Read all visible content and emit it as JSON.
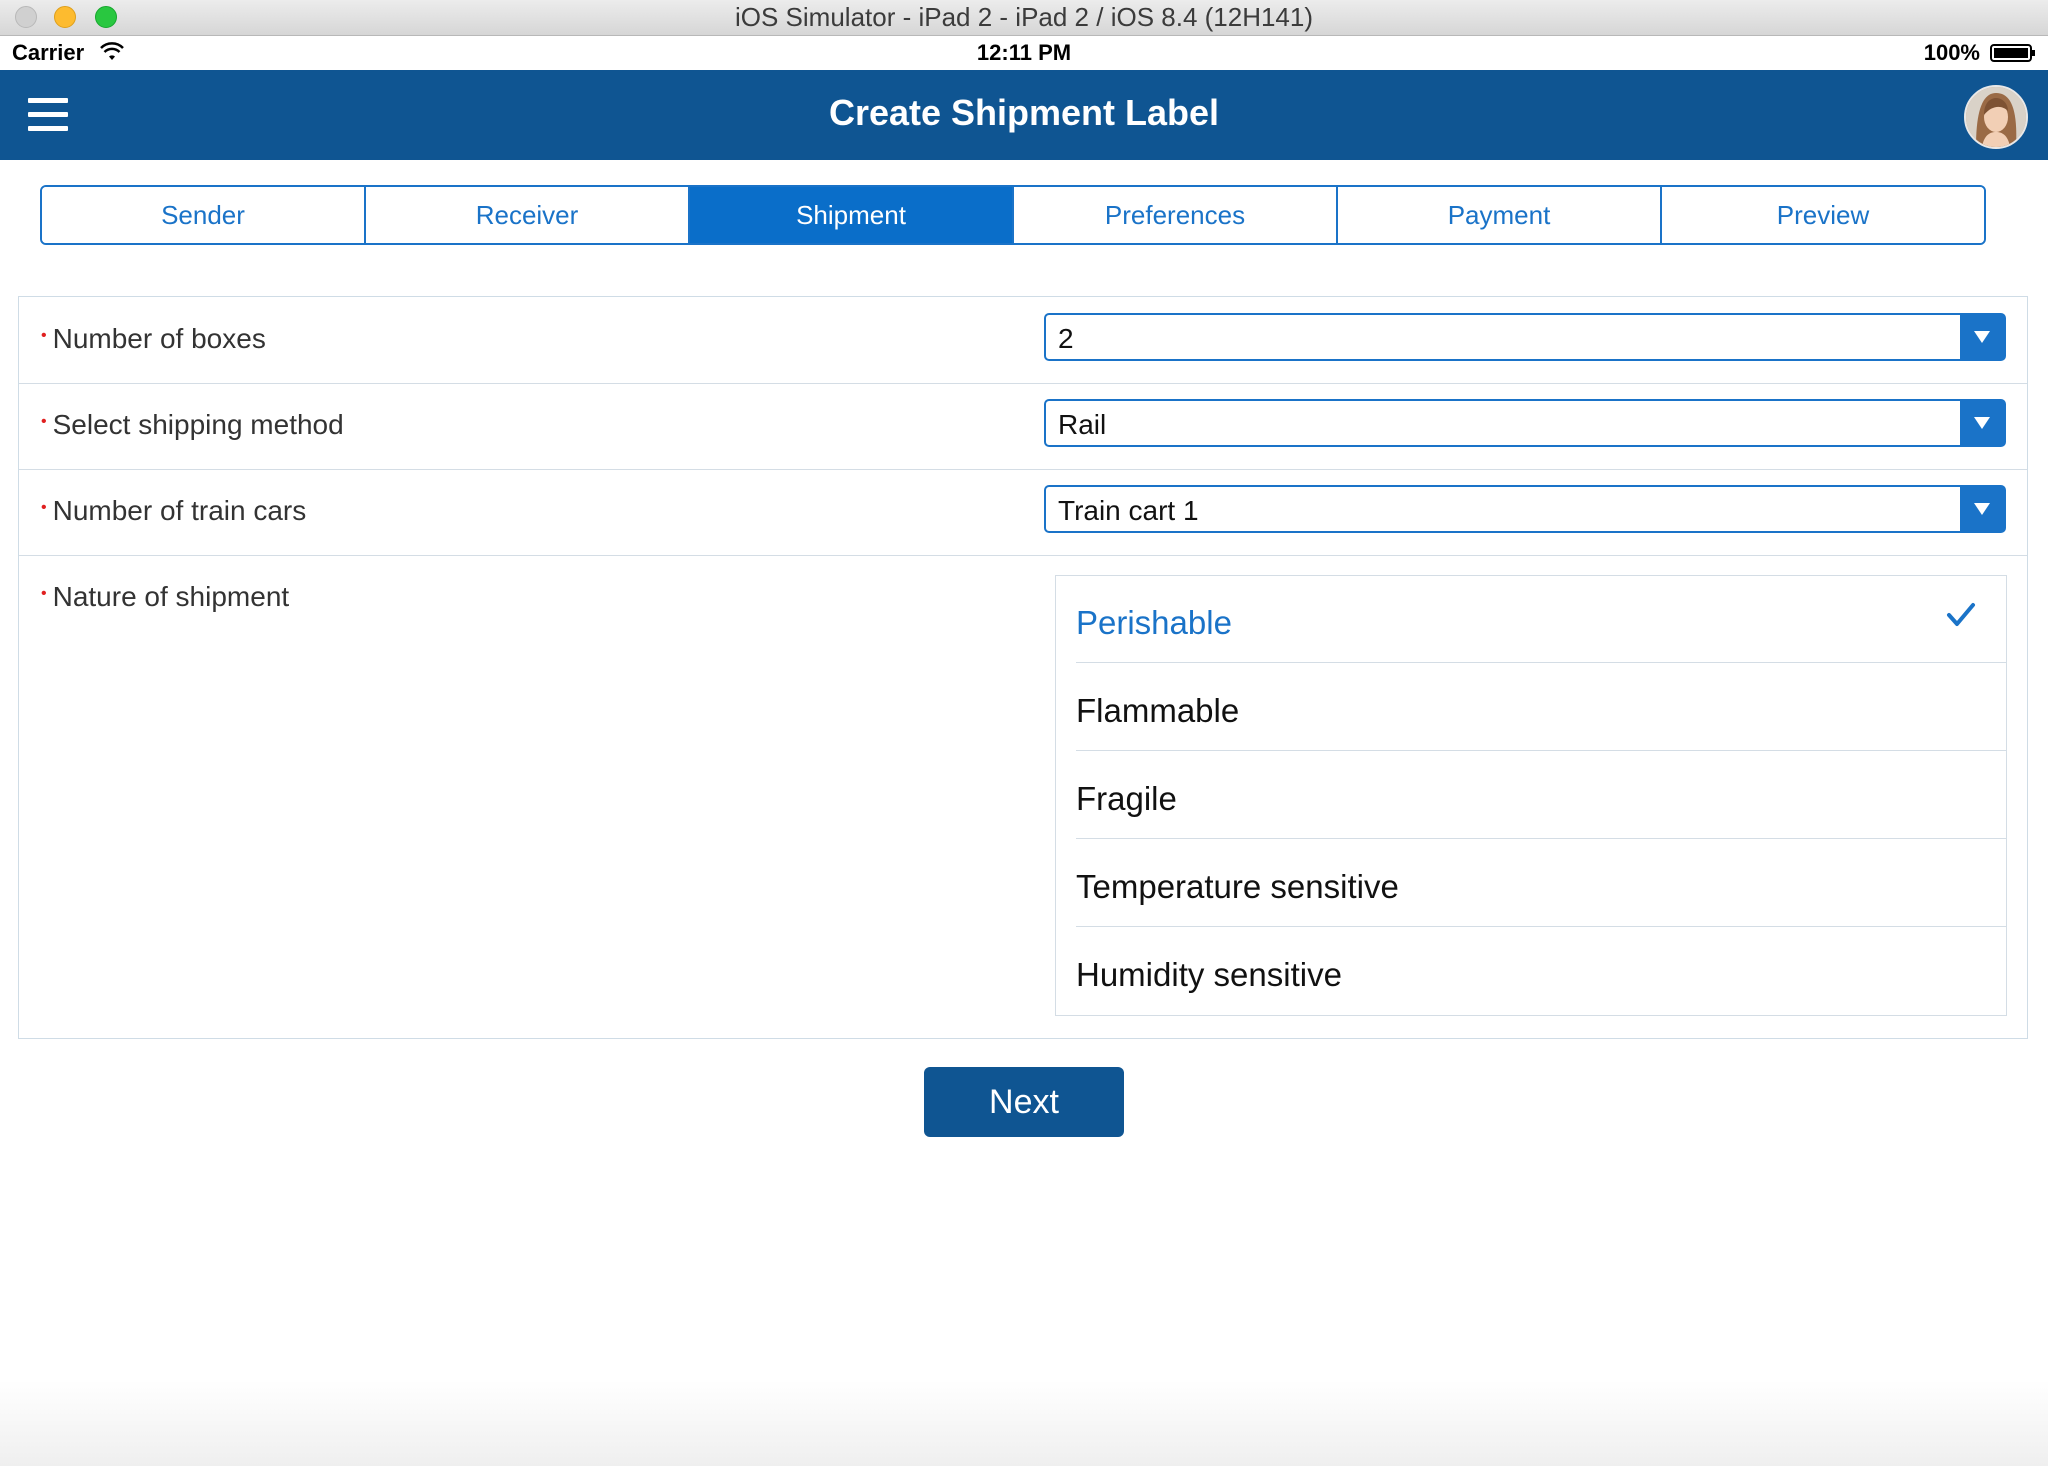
{
  "window": {
    "title": "iOS Simulator - iPad 2 - iPad 2 / iOS 8.4 (12H141)"
  },
  "status_bar": {
    "carrier": "Carrier",
    "time": "12:11 PM",
    "battery": "100%"
  },
  "nav": {
    "title": "Create Shipment Label"
  },
  "tabs": [
    {
      "label": "Sender"
    },
    {
      "label": "Receiver"
    },
    {
      "label": "Shipment"
    },
    {
      "label": "Preferences"
    },
    {
      "label": "Payment"
    },
    {
      "label": "Preview"
    }
  ],
  "active_tab": "Shipment",
  "form": {
    "number_of_boxes": {
      "label": "Number of boxes",
      "value": "2"
    },
    "shipping_method": {
      "label": "Select shipping method",
      "value": "Rail"
    },
    "train_cars": {
      "label": "Number of train cars",
      "value": "Train cart 1"
    },
    "nature": {
      "label": "Nature of shipment",
      "options": [
        {
          "label": "Perishable",
          "selected": true
        },
        {
          "label": "Flammable",
          "selected": false
        },
        {
          "label": "Fragile",
          "selected": false
        },
        {
          "label": "Temperature sensitive",
          "selected": false
        },
        {
          "label": "Humidity sensitive",
          "selected": false
        }
      ]
    }
  },
  "buttons": {
    "next": "Next"
  },
  "colors": {
    "nav_bg": "#0f5592",
    "accent": "#1a73c8",
    "required": "#e02020"
  }
}
